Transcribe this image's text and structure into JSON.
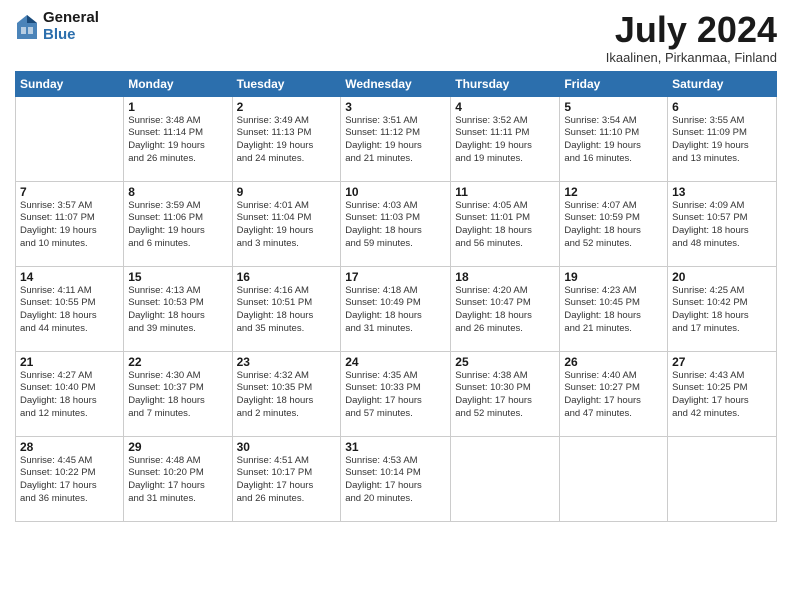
{
  "header": {
    "logo": {
      "general": "General",
      "blue": "Blue"
    },
    "title": "July 2024",
    "location": "Ikaalinen, Pirkanmaa, Finland"
  },
  "days_of_week": [
    "Sunday",
    "Monday",
    "Tuesday",
    "Wednesday",
    "Thursday",
    "Friday",
    "Saturday"
  ],
  "weeks": [
    [
      {
        "day": "",
        "info": ""
      },
      {
        "day": "1",
        "info": "Sunrise: 3:48 AM\nSunset: 11:14 PM\nDaylight: 19 hours\nand 26 minutes."
      },
      {
        "day": "2",
        "info": "Sunrise: 3:49 AM\nSunset: 11:13 PM\nDaylight: 19 hours\nand 24 minutes."
      },
      {
        "day": "3",
        "info": "Sunrise: 3:51 AM\nSunset: 11:12 PM\nDaylight: 19 hours\nand 21 minutes."
      },
      {
        "day": "4",
        "info": "Sunrise: 3:52 AM\nSunset: 11:11 PM\nDaylight: 19 hours\nand 19 minutes."
      },
      {
        "day": "5",
        "info": "Sunrise: 3:54 AM\nSunset: 11:10 PM\nDaylight: 19 hours\nand 16 minutes."
      },
      {
        "day": "6",
        "info": "Sunrise: 3:55 AM\nSunset: 11:09 PM\nDaylight: 19 hours\nand 13 minutes."
      }
    ],
    [
      {
        "day": "7",
        "info": "Sunrise: 3:57 AM\nSunset: 11:07 PM\nDaylight: 19 hours\nand 10 minutes."
      },
      {
        "day": "8",
        "info": "Sunrise: 3:59 AM\nSunset: 11:06 PM\nDaylight: 19 hours\nand 6 minutes."
      },
      {
        "day": "9",
        "info": "Sunrise: 4:01 AM\nSunset: 11:04 PM\nDaylight: 19 hours\nand 3 minutes."
      },
      {
        "day": "10",
        "info": "Sunrise: 4:03 AM\nSunset: 11:03 PM\nDaylight: 18 hours\nand 59 minutes."
      },
      {
        "day": "11",
        "info": "Sunrise: 4:05 AM\nSunset: 11:01 PM\nDaylight: 18 hours\nand 56 minutes."
      },
      {
        "day": "12",
        "info": "Sunrise: 4:07 AM\nSunset: 10:59 PM\nDaylight: 18 hours\nand 52 minutes."
      },
      {
        "day": "13",
        "info": "Sunrise: 4:09 AM\nSunset: 10:57 PM\nDaylight: 18 hours\nand 48 minutes."
      }
    ],
    [
      {
        "day": "14",
        "info": "Sunrise: 4:11 AM\nSunset: 10:55 PM\nDaylight: 18 hours\nand 44 minutes."
      },
      {
        "day": "15",
        "info": "Sunrise: 4:13 AM\nSunset: 10:53 PM\nDaylight: 18 hours\nand 39 minutes."
      },
      {
        "day": "16",
        "info": "Sunrise: 4:16 AM\nSunset: 10:51 PM\nDaylight: 18 hours\nand 35 minutes."
      },
      {
        "day": "17",
        "info": "Sunrise: 4:18 AM\nSunset: 10:49 PM\nDaylight: 18 hours\nand 31 minutes."
      },
      {
        "day": "18",
        "info": "Sunrise: 4:20 AM\nSunset: 10:47 PM\nDaylight: 18 hours\nand 26 minutes."
      },
      {
        "day": "19",
        "info": "Sunrise: 4:23 AM\nSunset: 10:45 PM\nDaylight: 18 hours\nand 21 minutes."
      },
      {
        "day": "20",
        "info": "Sunrise: 4:25 AM\nSunset: 10:42 PM\nDaylight: 18 hours\nand 17 minutes."
      }
    ],
    [
      {
        "day": "21",
        "info": "Sunrise: 4:27 AM\nSunset: 10:40 PM\nDaylight: 18 hours\nand 12 minutes."
      },
      {
        "day": "22",
        "info": "Sunrise: 4:30 AM\nSunset: 10:37 PM\nDaylight: 18 hours\nand 7 minutes."
      },
      {
        "day": "23",
        "info": "Sunrise: 4:32 AM\nSunset: 10:35 PM\nDaylight: 18 hours\nand 2 minutes."
      },
      {
        "day": "24",
        "info": "Sunrise: 4:35 AM\nSunset: 10:33 PM\nDaylight: 17 hours\nand 57 minutes."
      },
      {
        "day": "25",
        "info": "Sunrise: 4:38 AM\nSunset: 10:30 PM\nDaylight: 17 hours\nand 52 minutes."
      },
      {
        "day": "26",
        "info": "Sunrise: 4:40 AM\nSunset: 10:27 PM\nDaylight: 17 hours\nand 47 minutes."
      },
      {
        "day": "27",
        "info": "Sunrise: 4:43 AM\nSunset: 10:25 PM\nDaylight: 17 hours\nand 42 minutes."
      }
    ],
    [
      {
        "day": "28",
        "info": "Sunrise: 4:45 AM\nSunset: 10:22 PM\nDaylight: 17 hours\nand 36 minutes."
      },
      {
        "day": "29",
        "info": "Sunrise: 4:48 AM\nSunset: 10:20 PM\nDaylight: 17 hours\nand 31 minutes."
      },
      {
        "day": "30",
        "info": "Sunrise: 4:51 AM\nSunset: 10:17 PM\nDaylight: 17 hours\nand 26 minutes."
      },
      {
        "day": "31",
        "info": "Sunrise: 4:53 AM\nSunset: 10:14 PM\nDaylight: 17 hours\nand 20 minutes."
      },
      {
        "day": "",
        "info": ""
      },
      {
        "day": "",
        "info": ""
      },
      {
        "day": "",
        "info": ""
      }
    ]
  ]
}
